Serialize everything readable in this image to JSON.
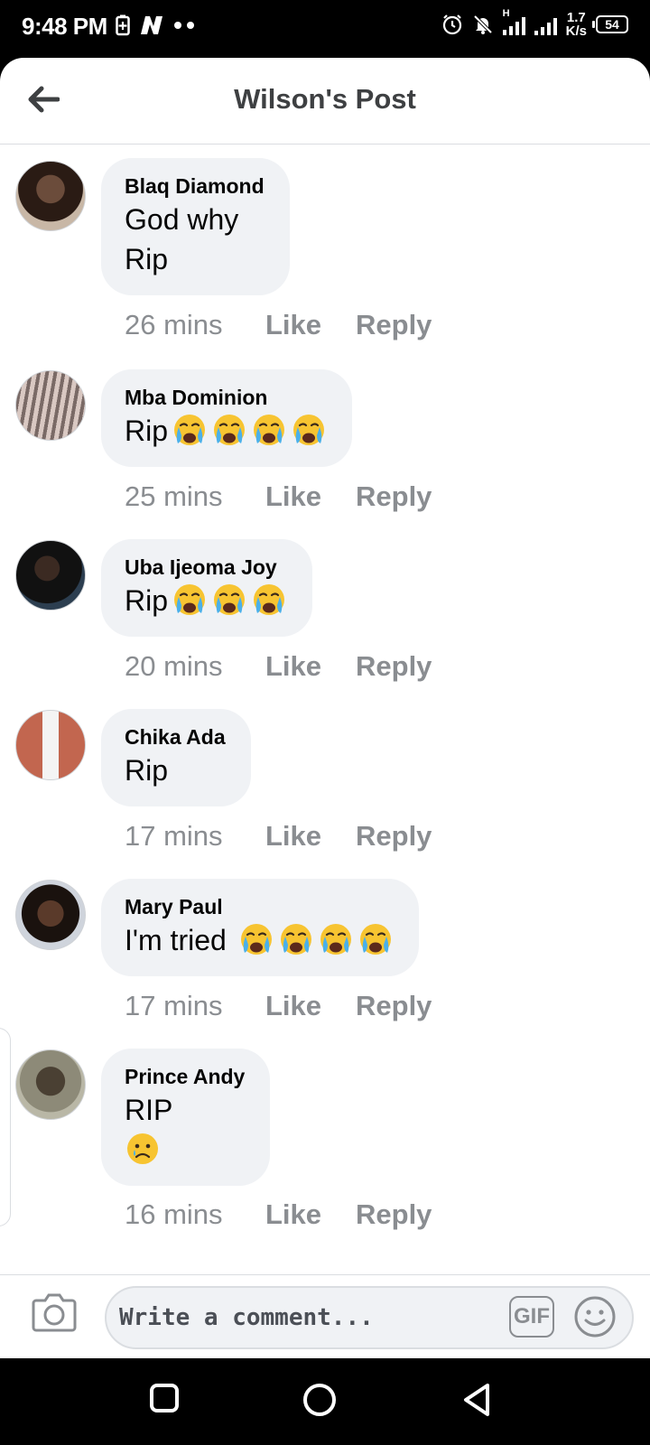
{
  "status_bar": {
    "time": "9:48 PM",
    "left_icons": [
      "battery-saver-icon",
      "n-app-icon",
      "more-dots-icon"
    ],
    "right_icons": [
      "alarm-icon",
      "mute-icon",
      "signal-icon",
      "signal-icon-2"
    ],
    "network_type": "H",
    "speed_value": "1.7",
    "speed_unit": "K/s",
    "battery": "54"
  },
  "header": {
    "back_icon": "back-arrow-icon",
    "title": "Wilson's Post"
  },
  "comments": [
    {
      "author": "Blaq Diamond",
      "lines": [
        "God why",
        "Rip"
      ],
      "emoji_line": "",
      "emoji_count": 0,
      "time": "26 mins",
      "like": "Like",
      "reply": "Reply"
    },
    {
      "author": "Mba Dominion",
      "lines": [
        "Rip"
      ],
      "emoji_line": "",
      "emoji_count": 4,
      "time": "25 mins",
      "like": "Like",
      "reply": "Reply"
    },
    {
      "author": "Uba Ijeoma Joy",
      "lines": [
        "Rip"
      ],
      "emoji_line": "",
      "emoji_count": 3,
      "time": "20 mins",
      "like": "Like",
      "reply": "Reply"
    },
    {
      "author": "Chika Ada",
      "lines": [
        "Rip"
      ],
      "emoji_line": "",
      "emoji_count": 0,
      "time": "17 mins",
      "like": "Like",
      "reply": "Reply"
    },
    {
      "author": "Mary Paul",
      "lines": [
        "I'm tried "
      ],
      "emoji_line": "",
      "emoji_count": 4,
      "time": "17 mins",
      "like": "Like",
      "reply": "Reply"
    },
    {
      "author": "Prince Andy",
      "lines": [
        "RIP"
      ],
      "emoji_line": "sad",
      "emoji_count": 0,
      "time": "16 mins",
      "like": "Like",
      "reply": "Reply"
    }
  ],
  "composer": {
    "camera_icon": "camera-icon",
    "placeholder": "Write a comment...",
    "gif_label": "GIF",
    "emoji_icon": "smiley-icon"
  },
  "nav_bar": {
    "icons": [
      "recents-square-icon",
      "home-circle-icon",
      "back-triangle-icon"
    ]
  },
  "colors": {
    "bubble": "#f0f2f5",
    "meta_text": "#8a8d91",
    "title_text": "#3e4042"
  }
}
